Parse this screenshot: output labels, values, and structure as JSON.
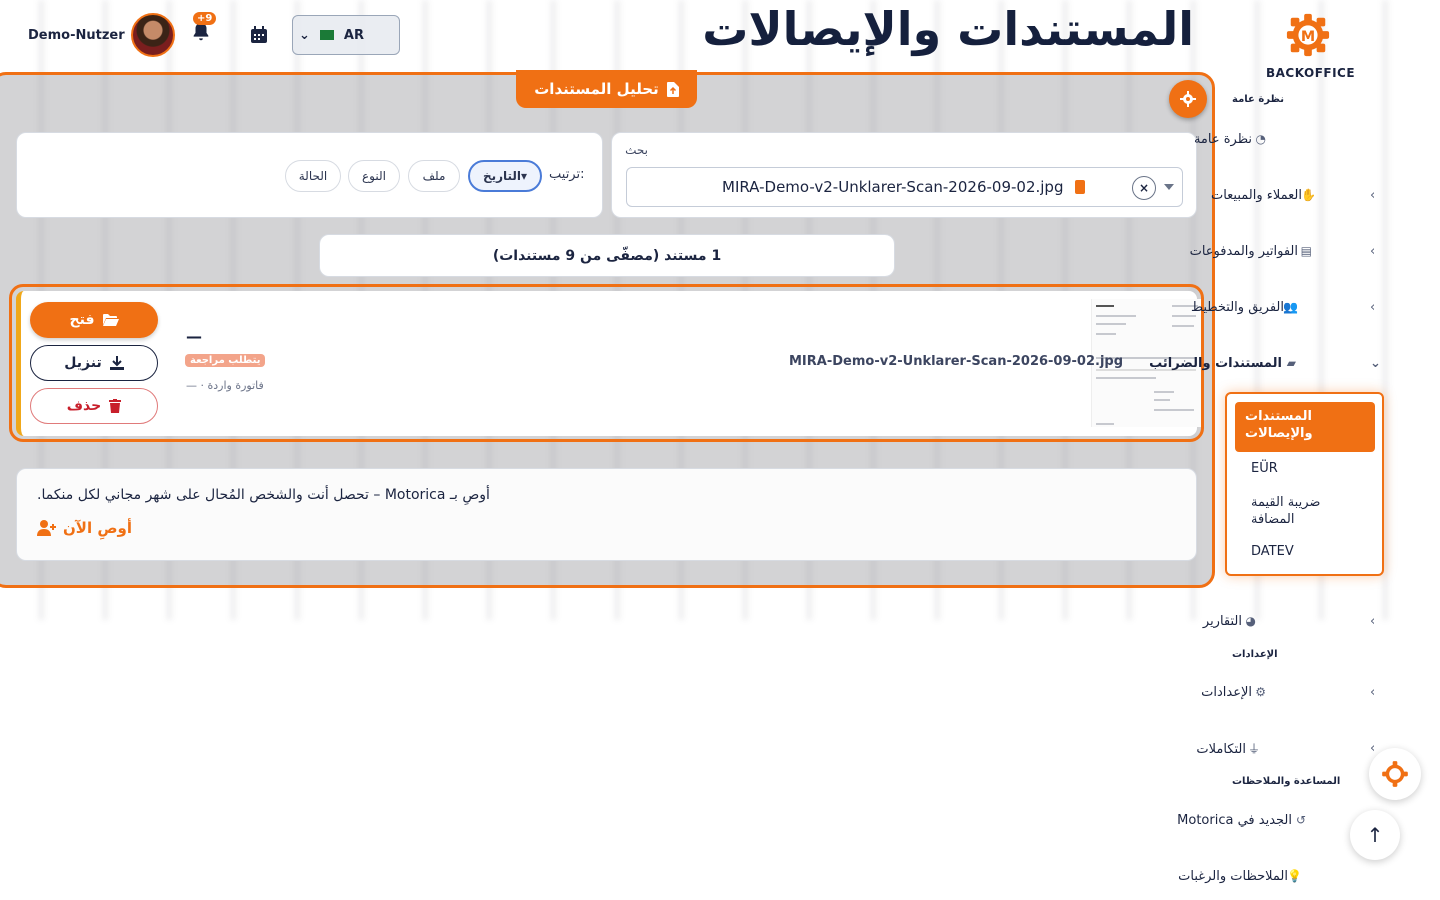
{
  "header": {
    "user_name": "Demo-Nutzer",
    "notification_count": "+9",
    "language": "AR",
    "page_title": "المستندات والإيصالات"
  },
  "logo": {
    "text": "BACKOFFICE"
  },
  "analyze_tab": {
    "label": "تحليل المستندات"
  },
  "search": {
    "label": "بحث",
    "value": "MIRA-Demo-v2-Unklarer-Scan-2026-09-02.jpg",
    "clear": "×"
  },
  "sort": {
    "label": "ترتيب:",
    "options": [
      "التاريخ▾",
      "ملف",
      "النوع",
      "الحالة"
    ],
    "active": "التاريخ▾"
  },
  "count_text": "1 مستند (مصفّى من 9 مستندات)",
  "document": {
    "filename": "MIRA-Demo-v2-Unklarer-Scan-2026-09-02.jpg",
    "dash": "—",
    "badge": "يتطلب مراجعة",
    "meta": "فاتورة واردة · —",
    "open_label": "فتح",
    "download_label": "تنزيل",
    "delete_label": "حذف"
  },
  "referral": {
    "text": "أوصِ بـ Motorica – تحصل أنت والشخص المُحال على شهر مجاني لكل منكما.",
    "link": "أوصِ الآن"
  },
  "sidebar": {
    "section_overview": "نظرة عامة",
    "overview_item": "نظرة عامة",
    "customers": "العملاء والمبيعات",
    "invoices": "الفواتير والمدفوعات",
    "team": "الفريق والتخطيط",
    "documents": "المستندات والضرائب",
    "sub_items": {
      "active": "المستندات والإيصالات",
      "euer": "EÜR",
      "vat": "ضريبة القيمة المضافة",
      "datev": "DATEV"
    },
    "reports": "التقارير",
    "section_settings": "الإعدادات",
    "settings": "الإعدادات",
    "integrations": "التكاملات",
    "section_help": "المساعدة والملاحظات",
    "whats_new": "الجديد في Motorica",
    "feedback": "الملاحظات والرغبات"
  },
  "colors": {
    "accent": "#f07014",
    "navy": "#15203d",
    "danger": "#c81f2b",
    "warning_border": "#f0a81a"
  }
}
